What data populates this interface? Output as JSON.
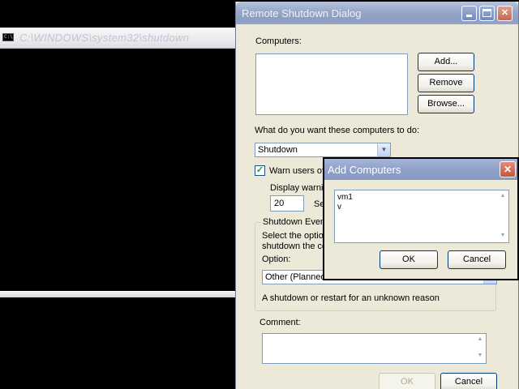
{
  "console": {
    "title": "C:\\WINDOWS\\system32\\shutdown",
    "icon_text": "C:\\"
  },
  "dialog": {
    "title": "Remote Shutdown Dialog",
    "computers_label": "Computers:",
    "add_button": "Add...",
    "remove_button": "Remove",
    "browse_button": "Browse...",
    "action_label": "What do you want these computers to do:",
    "action_value": "Shutdown",
    "warn_label": "Warn users of",
    "warn_checked": true,
    "display_warning_label": "Display warnin",
    "seconds_value": "20",
    "seconds_label": "Se",
    "shutdown_event_label": "Shutdown Even",
    "select_option_text_1": "Select the optio",
    "select_option_text_2": "shutdown the co",
    "option_label": "Option:",
    "option_value": "Other (Planned",
    "option_description": "A shutdown or restart for an unknown reason",
    "comment_label": "Comment:",
    "ok_button": "OK",
    "cancel_button": "Cancel"
  },
  "add_computers": {
    "title": "Add Computers",
    "lines": [
      "vm1",
      "v"
    ],
    "ok_button": "OK",
    "cancel_button": "Cancel"
  },
  "icons": {
    "minimize": "minimize-icon",
    "maximize": "maximize-icon",
    "close": "close-icon",
    "dropdown": "chevron-down-icon"
  },
  "colors": {
    "dialog_face": "#ece9d8",
    "inactive_titlebar": "#9aa9c9",
    "close_button": "#c4553c",
    "field_border": "#7f9db9"
  }
}
